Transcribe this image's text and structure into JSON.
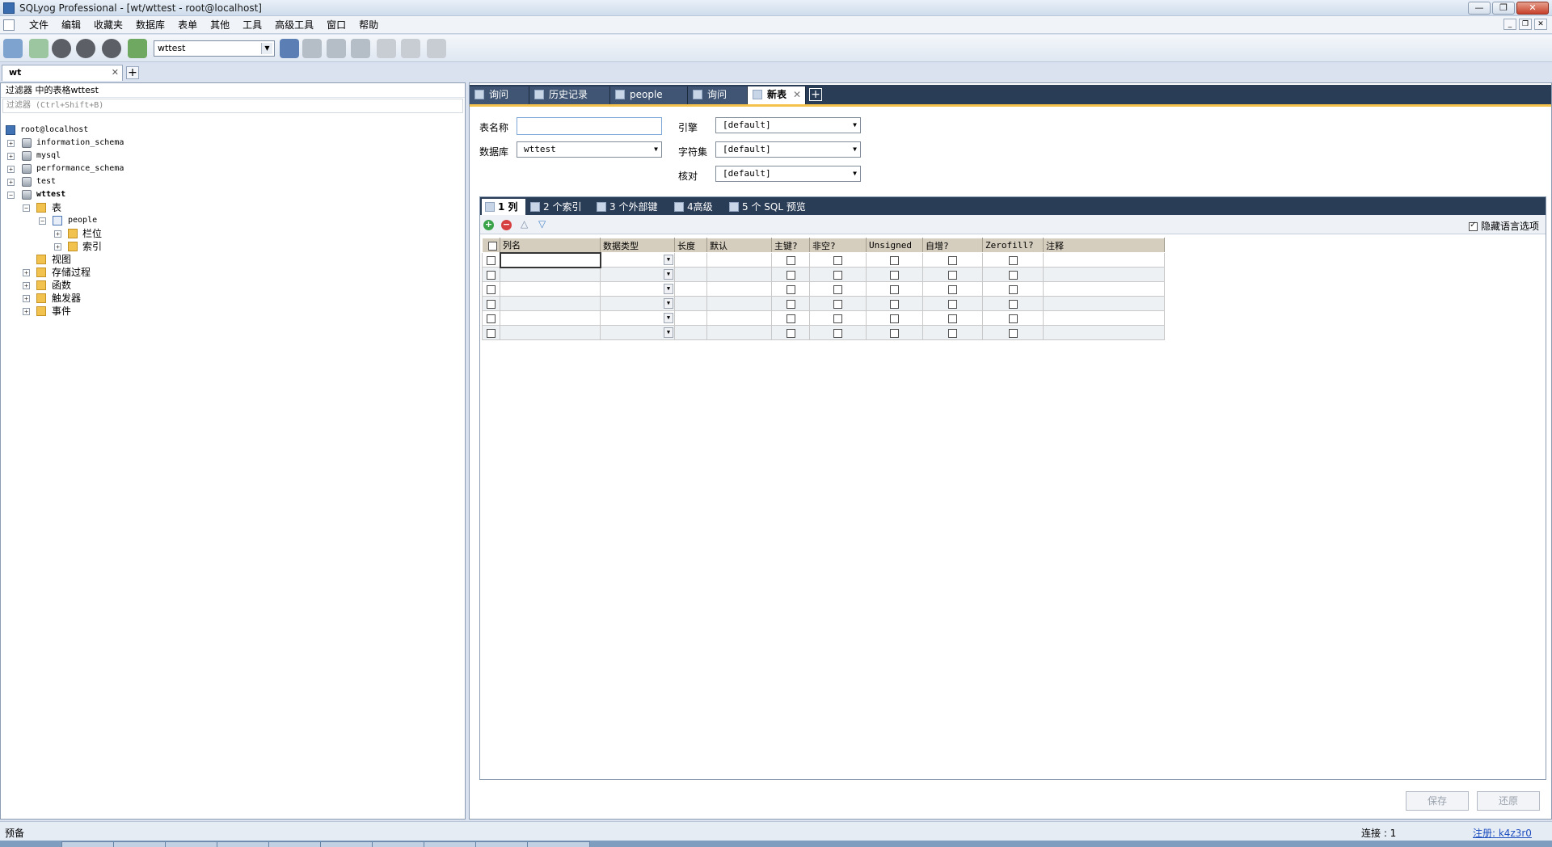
{
  "window": {
    "title": "SQLyog Professional - [wt/wttest - root@localhost]"
  },
  "menu": [
    "文件",
    "编辑",
    "收藏夹",
    "数据库",
    "表单",
    "其他",
    "工具",
    "高级工具",
    "窗口",
    "帮助"
  ],
  "toolbar": {
    "db_select": "wttest"
  },
  "connection_tab": {
    "label": "wt"
  },
  "filter": {
    "title": "过滤器 中的表格wttest",
    "placeholder": "过滤器 (Ctrl+Shift+B)"
  },
  "tree": {
    "root": "root@localhost",
    "dbs": [
      "information_schema",
      "mysql",
      "performance_schema",
      "test",
      "wttest"
    ],
    "tables_folder": "表",
    "table": "people",
    "columns_folder": "栏位",
    "indexes_folder": "索引",
    "views": "视图",
    "procs": "存储过程",
    "funcs": "函数",
    "triggers": "触发器",
    "events": "事件"
  },
  "query_tabs": [
    "询问",
    "历史记录",
    "people",
    "询问",
    "新表"
  ],
  "form": {
    "table_name_label": "表名称",
    "table_name_value": "",
    "database_label": "数据库",
    "database_value": "wttest",
    "engine_label": "引擎",
    "engine_value": "[default]",
    "charset_label": "字符集",
    "charset_value": "[default]",
    "collation_label": "核对",
    "collation_value": "[default]"
  },
  "sub_tabs": [
    "1 列",
    "2 个索引",
    "3 个外部键",
    "4高级",
    "5 个 SQL 预览"
  ],
  "hide_lang": {
    "label": "隐藏语言选项",
    "checked": true
  },
  "grid": {
    "headers": [
      "列名",
      "数据类型",
      "长度",
      "默认",
      "主键?",
      "非空?",
      "Unsigned",
      "自增?",
      "Zerofill?",
      "注释"
    ],
    "row_count": 6
  },
  "buttons": {
    "save": "保存",
    "revert": "还原"
  },
  "status": {
    "left": "预备",
    "connection": "连接 : 1",
    "registration": "注册:  k4z3r0"
  }
}
